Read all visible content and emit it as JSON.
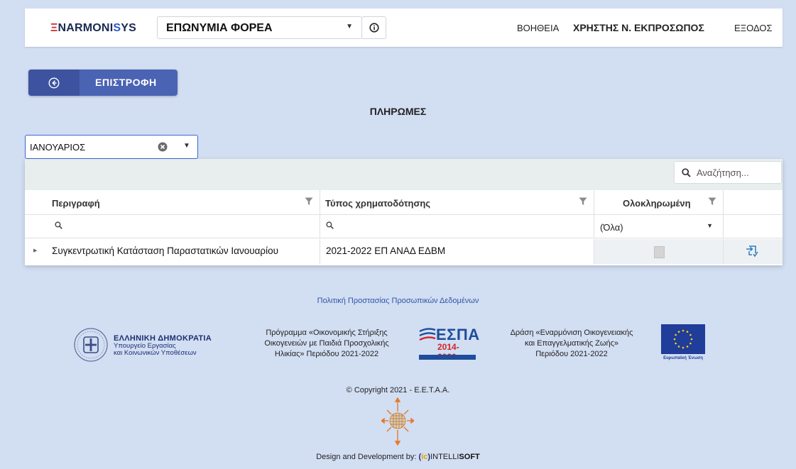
{
  "header": {
    "logo": {
      "part1": "Ξ",
      "part2": "NARMONI",
      "part3": "S",
      "part4": "YS"
    },
    "org_select_value": "ΕΠΩΝΥΜΙΑ ΦΟΡΕΑ",
    "nav": {
      "help": "ΒΟΗΘΕΙΑ",
      "user": "ΧΡΗΣΤΗΣ Ν. ΕΚΠΡΟΣΩΠΟΣ",
      "exit": "ΕΞΟΔΟΣ"
    }
  },
  "back_button": {
    "label": "ΕΠΙΣΤΡΟΦΗ",
    "icon": "arrow-left-circle-icon"
  },
  "page": {
    "title": "ΠΛΗΡΩΜΕΣ"
  },
  "month_filter": {
    "value": "ΙΑΝΟΥΑΡΙΟΣ"
  },
  "grid": {
    "search_placeholder": "Αναζήτηση...",
    "columns": [
      {
        "label": "Περιγραφή"
      },
      {
        "label": "Τύπος χρηματοδότησης"
      },
      {
        "label": "Ολοκληρωμένη"
      }
    ],
    "completed_filter_value": "(Όλα)",
    "rows": [
      {
        "description": "Συγκεντρωτική Κατάσταση Παραστατικών Ιανουαρίου",
        "funding_type": "2021-2022 ΕΠ ΑΝΑΔ ΕΔΒΜ",
        "completed": false
      }
    ]
  },
  "footer": {
    "privacy_link": "Πολιτική Προστασίας Προσωπικών Δεδομένων",
    "ministry": {
      "title": "ΕΛΛΗΝΙΚΗ ΔΗΜΟΚΡΑΤΙΑ",
      "line1": "Υπουργείο Εργασίας",
      "line2": "και Κοινωνικών Υποθέσεων"
    },
    "program": {
      "line1": "Πρόγραμμα «Οικονομικής Στήριξης",
      "line2": "Οικογενειών με Παιδιά Προσχολικής",
      "line3": "Ηλικίας» Περιόδου 2021-2022"
    },
    "espa": {
      "word": "ΕΣΠΑ",
      "years": "2014-2020"
    },
    "action": {
      "line1": "Δράση «Εναρμόνιση Οικογενειακής",
      "line2": "και Επαγγελματικής Ζωής»",
      "line3": "Περιόδου 2021-2022"
    },
    "eu_caption": "Ευρωπαϊκή Ένωση",
    "copyright": "© Copyright 2021 - E.E.T.A.A.",
    "dev": {
      "prefix": "Design and Development by:",
      "brand1": "INTELLI",
      "brand2": "SOFT"
    }
  }
}
